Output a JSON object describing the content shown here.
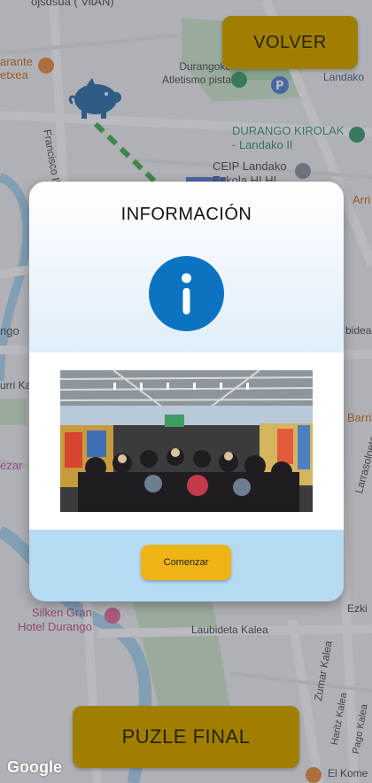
{
  "header": {
    "back_label": "VOLVER"
  },
  "footer": {
    "final_puzzle_label": "PUZLE FINAL"
  },
  "modal": {
    "title": "INFORMACIÓN",
    "start_label": "Comenzar"
  },
  "map": {
    "attribution": "Google",
    "labels": {
      "top": "ojsdsua ( VitAN)",
      "restaurant": "arante\netxea",
      "street_francisco": "Francisco Ibarra Kalea",
      "stadium": "Durangoko\nAtletismo pista",
      "landako": "Landako",
      "kirolak": "DURANGO KIROLAK\n- Landako II",
      "ceip": "CEIP Landako\nEskola HLHI",
      "arri": "Arri",
      "ngo": "ngo",
      "bidea": "bidea",
      "urri": "urri Kalea",
      "ezar": "ezar",
      "barri": "Barri",
      "larrasoloeta": "Larrasoloeta",
      "silken": "Silken Gran\nHotel Durango",
      "laubideta": "Laubideta Kalea",
      "ezki": "Ezki",
      "zumar": "Zumar Kalea",
      "haritz": "Haritz Kalea",
      "pago": "Pago Kalea",
      "elkome": "El Kome"
    }
  },
  "colors": {
    "button_gold": "#a07f00",
    "info_blue": "#0b73c2",
    "start_yellow": "#edb414",
    "footer_blue": "#b6daf2"
  },
  "icons": {
    "player_marker": "piggy-bank-icon",
    "info": "info-icon",
    "parking": "parking-icon",
    "place": "map-pin-icon",
    "hotel": "hotel-icon",
    "food": "restaurant-icon"
  }
}
